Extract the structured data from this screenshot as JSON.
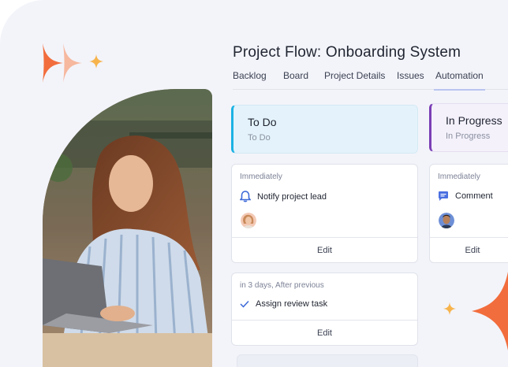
{
  "project": {
    "title": "Project Flow: Onboarding System"
  },
  "tabs": [
    {
      "label": "Backlog"
    },
    {
      "label": "Board"
    },
    {
      "label": "Project Details"
    },
    {
      "label": "Issues"
    },
    {
      "label": "Automation",
      "active": true
    }
  ],
  "columns": {
    "todo": {
      "title": "To Do",
      "subtitle": "To Do",
      "accent": "#1ab2e4"
    },
    "in_progress": {
      "title": "In Progress",
      "subtitle": "In Progress",
      "accent": "#7b3fb5"
    }
  },
  "cards": [
    {
      "when": "Immediately",
      "action": "Notify project lead",
      "icon": "bell-icon",
      "edit_label": "Edit"
    },
    {
      "when": "Immediately",
      "action": "Comment",
      "icon": "comment-icon",
      "edit_label": "Edit"
    },
    {
      "when": "in 3 days, After previous",
      "action": "Assign review task",
      "icon": "checkmark-icon",
      "edit_label": "Edit"
    }
  ],
  "colors": {
    "brand_orange": "#f26d3d",
    "sparkle_yellow": "#f7b44d",
    "tab_underline": "#b9c4ef"
  }
}
